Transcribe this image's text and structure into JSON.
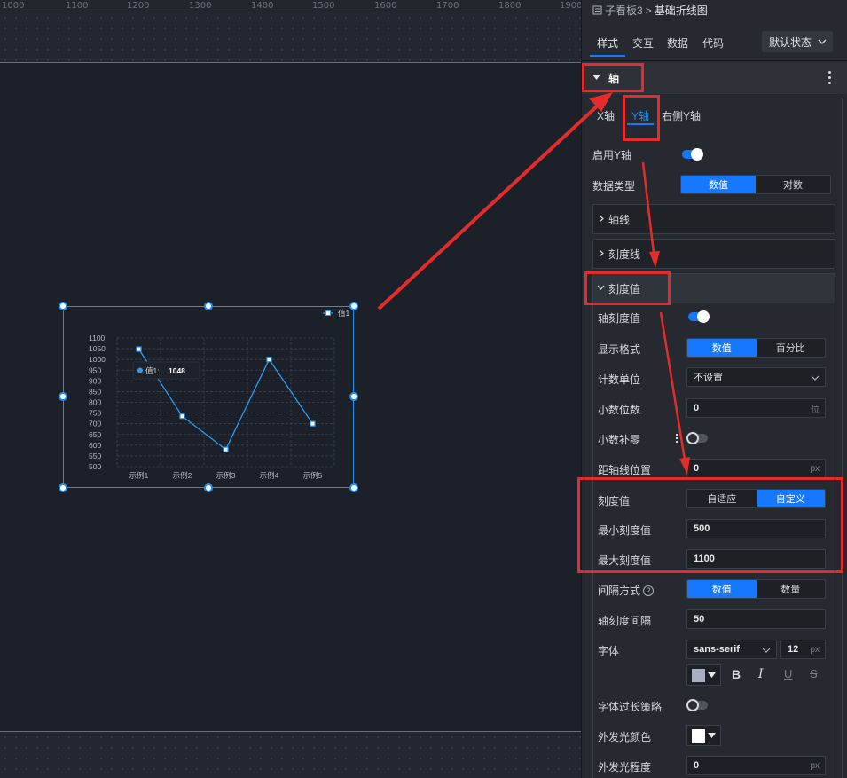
{
  "ruler": {
    "ticks": [
      "1000",
      "1100",
      "1200",
      "1300",
      "1400",
      "1500",
      "1600",
      "1700",
      "1800",
      "1900"
    ]
  },
  "chart_data": {
    "type": "line",
    "categories": [
      "示例1",
      "示例2",
      "示例3",
      "示例4",
      "示例5"
    ],
    "series": [
      {
        "name": "值1",
        "values": [
          1048,
          735,
          580,
          1000,
          700
        ]
      }
    ],
    "yticks": [
      "1100",
      "1050",
      "1000",
      "950",
      "900",
      "850",
      "800",
      "750",
      "700",
      "650",
      "600",
      "550",
      "500"
    ],
    "ylim": [
      500,
      1100
    ],
    "grid": true,
    "legend": "top-right",
    "tooltip": {
      "label": "值1:",
      "value": "1048"
    },
    "line_color": "#2d9cf0"
  },
  "panel": {
    "breadcrumb_root": "子看板3",
    "breadcrumb_sep": ">",
    "breadcrumb_current": "基础折线图",
    "tabs": [
      "样式",
      "交互",
      "数据",
      "代码"
    ],
    "state_select": "默认状态",
    "section_axis": "轴",
    "subtabs": [
      "X轴",
      "Y轴",
      "右侧Y轴"
    ],
    "enable_y": "启用Y轴",
    "data_type_label": "数据类型",
    "data_type_options": [
      "数值",
      "对数"
    ],
    "axis_line": "轴线",
    "tick_line": "刻度线",
    "tick_value_section": "刻度值",
    "axis_tick_value": "轴刻度值",
    "display_format": "显示格式",
    "display_format_options": [
      "数值",
      "百分比"
    ],
    "count_unit": "计数单位",
    "count_unit_value": "不设置",
    "decimals": "小数位数",
    "decimals_value": "0",
    "decimals_suffix": "位",
    "decimal_pad": "小数补零",
    "axis_offset": "距轴线位置",
    "axis_offset_value": "0",
    "px": "px",
    "tick_mode": "刻度值",
    "tick_mode_options": [
      "自适应",
      "自定义"
    ],
    "min_tick": "最小刻度值",
    "min_tick_value": "500",
    "max_tick": "最大刻度值",
    "max_tick_value": "1100",
    "interval_mode": "间隔方式",
    "interval_mode_options": [
      "数值",
      "数量"
    ],
    "tick_interval": "轴刻度间隔",
    "tick_interval_value": "50",
    "font": "字体",
    "font_family": "sans-serif",
    "font_size": "12",
    "overflow": "字体过长策略",
    "glow_color": "外发光颜色",
    "glow_level": "外发光程度",
    "glow_level_value": "0",
    "font_color": "#a9b0c2"
  }
}
